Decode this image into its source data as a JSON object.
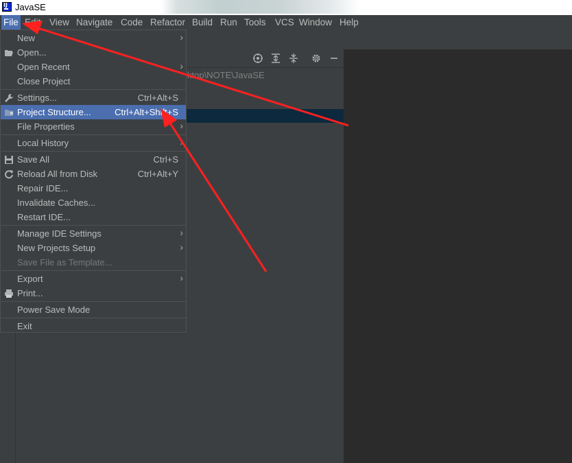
{
  "window": {
    "title": "JavaSE"
  },
  "menubar": [
    {
      "label": "File"
    },
    {
      "label": "Edit"
    },
    {
      "label": "View"
    },
    {
      "label": "Navigate"
    },
    {
      "label": "Code"
    },
    {
      "label": "Refactor"
    },
    {
      "label": "Build"
    },
    {
      "label": "Run"
    },
    {
      "label": "Tools"
    },
    {
      "label": "VCS"
    },
    {
      "label": "Window"
    },
    {
      "label": "Help"
    }
  ],
  "project_panel": {
    "path_fragment": "ktop\\NOTE\\JavaSE"
  },
  "file_menu": {
    "new": {
      "label": "New"
    },
    "open": {
      "label": "Open..."
    },
    "open_recent": {
      "label": "Open Recent"
    },
    "close_project": {
      "label": "Close Project"
    },
    "settings": {
      "label": "Settings...",
      "shortcut": "Ctrl+Alt+S"
    },
    "project_structure": {
      "label": "Project Structure...",
      "shortcut": "Ctrl+Alt+Shift+S"
    },
    "file_properties": {
      "label": "File Properties"
    },
    "local_history": {
      "label": "Local History"
    },
    "save_all": {
      "label": "Save All",
      "shortcut": "Ctrl+S"
    },
    "reload_all": {
      "label": "Reload All from Disk",
      "shortcut": "Ctrl+Alt+Y"
    },
    "repair_ide": {
      "label": "Repair IDE..."
    },
    "invalidate_caches": {
      "label": "Invalidate Caches..."
    },
    "restart_ide": {
      "label": "Restart IDE..."
    },
    "manage_ide_settings": {
      "label": "Manage IDE Settings"
    },
    "new_projects_setup": {
      "label": "New Projects Setup"
    },
    "save_file_as_template": {
      "label": "Save File as Template..."
    },
    "export": {
      "label": "Export"
    },
    "print": {
      "label": "Print..."
    },
    "power_save_mode": {
      "label": "Power Save Mode"
    },
    "exit": {
      "label": "Exit"
    }
  },
  "icons": {
    "open": "folder-open-icon",
    "settings": "wrench-icon",
    "project_structure": "folder-icon",
    "save_all": "floppy-disk-icon",
    "reload": "reload-icon",
    "print": "printer-icon",
    "submenu": "chevron-right-icon"
  },
  "colors": {
    "selection": "#4b6eaf",
    "menu_bg": "#3c3f41",
    "annotation_arrow": "#ff2020"
  }
}
